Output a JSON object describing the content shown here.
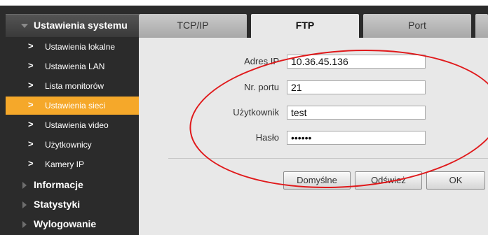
{
  "sidebar": {
    "header": "Ustawienia systemu",
    "items": [
      {
        "label": "Ustawienia lokalne"
      },
      {
        "label": "Ustawienia LAN"
      },
      {
        "label": "Lista monitorów"
      },
      {
        "label": "Ustawienia sieci",
        "active": true
      },
      {
        "label": "Ustawienia video"
      },
      {
        "label": "Użytkownicy"
      },
      {
        "label": "Kamery IP"
      }
    ],
    "sections": [
      {
        "label": "Informacje"
      },
      {
        "label": "Statystyki"
      },
      {
        "label": "Wylogowanie"
      }
    ],
    "active_color": "#f5a82a"
  },
  "tabs": [
    {
      "label": "TCP/IP"
    },
    {
      "label": "FTP",
      "active": true
    },
    {
      "label": "Port"
    }
  ],
  "form": {
    "ip_label": "Adres IP",
    "ip_value": "10.36.45.136",
    "port_label": "Nr. portu",
    "port_value": "21",
    "user_label": "Użytkownik",
    "user_value": "test",
    "password_label": "Hasło",
    "password_value": "secret"
  },
  "buttons": {
    "default": "Domyślne",
    "refresh": "Odśwież",
    "ok": "OK"
  },
  "annotation_color": "#e0191b"
}
